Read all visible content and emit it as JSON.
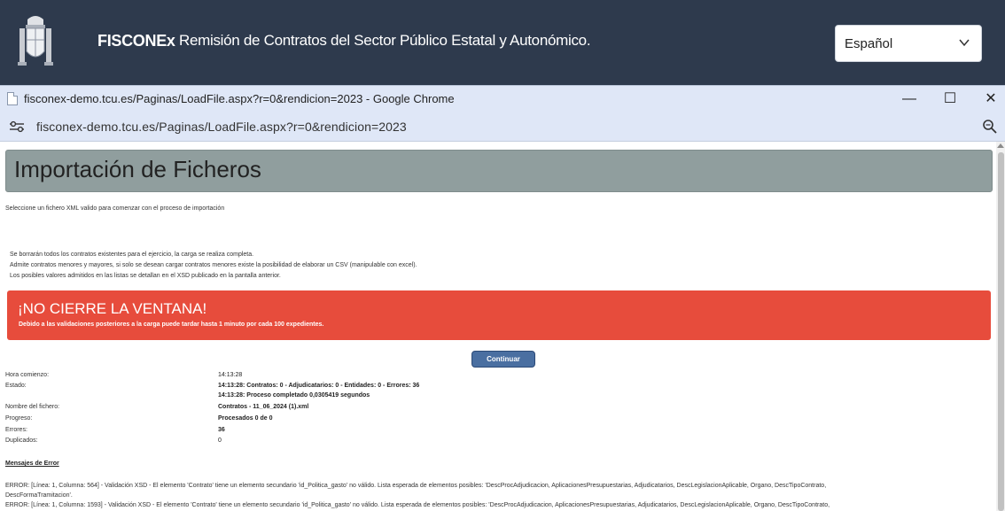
{
  "app": {
    "brand": "FISCONEx",
    "subtitle": "Remisión de Contratos del Sector Público Estatal y Autonómico.",
    "language": "Español"
  },
  "window": {
    "title": "fisconex-demo.tcu.es/Paginas/LoadFile.aspx?r=0&rendicion=2023 - Google Chrome",
    "url": "fisconex-demo.tcu.es/Paginas/LoadFile.aspx?r=0&rendicion=2023",
    "minimize": "—",
    "maximize": "☐",
    "close": "✕"
  },
  "page": {
    "title": "Importación de Ficheros",
    "instruction": "Seleccione un fichero XML valido para comenzar con el proceso de importación",
    "notes": [
      "Se borrarán todos los contratos existentes para el ejercicio, la carga se realiza completa.",
      "Admite contratos menores y mayores, si solo se desean cargar contratos menores existe la posibilidad de elaborar un CSV (manipulable con excel).",
      "Los posibles valores admitidos en las listas se detallan en el XSD publicado en la pantalla anterior."
    ],
    "alert": {
      "title": "¡NO CIERRE LA VENTANA!",
      "subtitle": "Debido a las validaciones posteriores a la carga puede tardar hasta 1 minuto por cada 100 expedientes."
    },
    "continue_button": "Continuar",
    "status": {
      "hora_label": "Hora comienzo:",
      "hora_value": "14:13:28",
      "estado_label": "Estado:",
      "estado_value_1": "14:13:28: Contratos: 0 - Adjudicatarios: 0 - Entidades: 0 - Errores: 36",
      "estado_value_2": "14:13:28: Proceso completado 0,0305419 segundos",
      "fichero_label": "Nombre del fichero:",
      "fichero_value": "Contratos - 11_06_2024 (1).xml",
      "progreso_label": "Progreso:",
      "progreso_value": "Procesados 0 de 0",
      "errores_label": "Errores:",
      "errores_value": "36",
      "duplicados_label": "Duplicados:",
      "duplicados_value": "0"
    },
    "errors": {
      "heading": "Mensajes de Error",
      "lines": [
        "ERROR: [Línea: 1, Columna: 564] - Validación XSD - El elemento 'Contrato' tiene un elemento secundario 'id_Politica_gasto' no válido. Lista esperada de elementos posibles: 'DescProcAdjudicacion, AplicacionesPresupuestarias, Adjudicatarios, DescLegislacionAplicable, Organo, DescTipoContrato,",
        "DescFormaTramitacion'.",
        "ERROR: [Línea: 1, Columna: 1593] - Validación XSD - El elemento 'Contrato' tiene un elemento secundario 'id_Politica_gasto' no válido. Lista esperada de elementos posibles: 'DescProcAdjudicacion, AplicacionesPresupuestarias, Adjudicatarios, DescLegislacionAplicable, Organo, DescTipoContrato,"
      ]
    }
  },
  "colors": {
    "appbar": "#2e3a4d",
    "header": "#909e9e",
    "alert": "#e74c3c",
    "button": "#4a6fa1"
  }
}
